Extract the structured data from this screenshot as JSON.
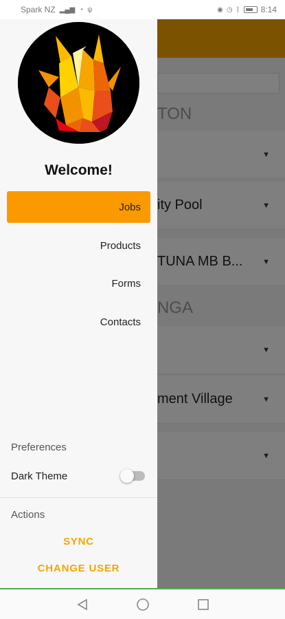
{
  "status_bar": {
    "carrier": "Spark NZ",
    "time": "8:14"
  },
  "background": {
    "sections": [
      "TON",
      "NGA"
    ],
    "rows": [
      "",
      "ity Pool",
      "TUNA MB B...",
      "",
      "ment Village",
      ""
    ]
  },
  "drawer": {
    "welcome": "Welcome!",
    "menu": [
      {
        "label": "Jobs",
        "active": true
      },
      {
        "label": "Products",
        "active": false
      },
      {
        "label": "Forms",
        "active": false
      },
      {
        "label": "Contacts",
        "active": false
      }
    ],
    "preferences_title": "Preferences",
    "dark_theme_label": "Dark Theme",
    "dark_theme_on": false,
    "actions_title": "Actions",
    "sync_label": "SYNC",
    "change_user_label": "CHANGE USER"
  },
  "colors": {
    "accent": "#f7a600",
    "active_menu": "#fb9900"
  },
  "nav_icons": [
    "back-icon",
    "home-icon",
    "recents-icon"
  ]
}
